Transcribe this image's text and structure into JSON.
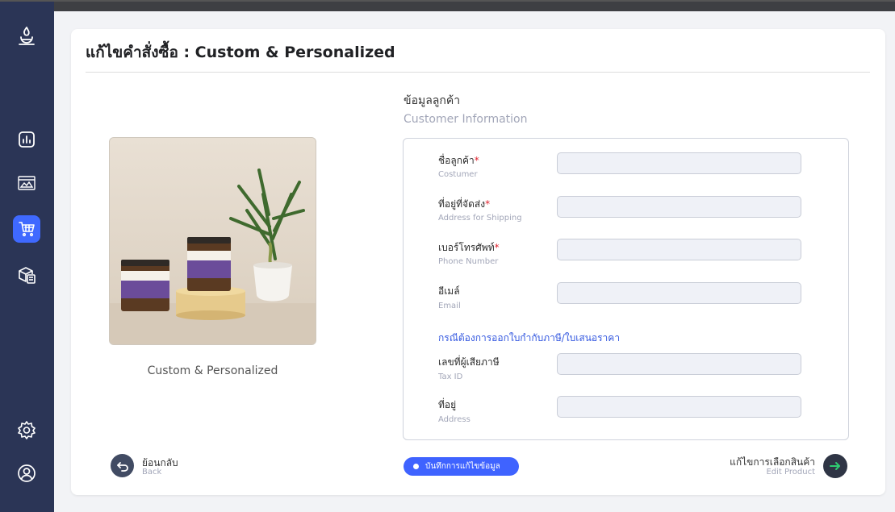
{
  "page": {
    "title": "แก้ไขคำสั่งซื้อ : Custom & Personalized"
  },
  "sidebar": {
    "items": [
      {
        "icon": "brand-logo-icon"
      },
      {
        "icon": "chart-icon"
      },
      {
        "icon": "banner-icon"
      },
      {
        "icon": "cart-icon",
        "active": true
      },
      {
        "icon": "product-box-icon"
      },
      {
        "icon": "gear-icon"
      },
      {
        "icon": "profile-icon"
      }
    ]
  },
  "product": {
    "image_icon": "product-photo",
    "name": "Custom & Personalized"
  },
  "customer": {
    "section_th": "ข้อมูลลูกค้า",
    "section_en": "Customer Information",
    "required_mark": "*",
    "fields": {
      "name": {
        "label_th": "ชื่อลูกค้า",
        "label_en": "Costumer",
        "value": ""
      },
      "address": {
        "label_th": "ที่อยู่ที่จัดส่ง",
        "label_en": "Address for Shipping",
        "value": ""
      },
      "phone": {
        "label_th": "เบอร์โทรศัพท์",
        "label_en": "Phone Number",
        "value": ""
      },
      "email": {
        "label_th": "อีเมล์",
        "label_en": "Email",
        "value": ""
      }
    },
    "tax_note": "กรณีต้องการออกใบกำกับภาษี/ใบเสนอราคา",
    "tax_fields": {
      "tax_id": {
        "label_th": "เลขที่ผู้เสียภาษี",
        "label_en": "Tax ID",
        "value": ""
      },
      "tax_address": {
        "label_th": "ที่อยู่",
        "label_en": "Address",
        "value": ""
      }
    }
  },
  "footer": {
    "back_th": "ย้อนกลับ",
    "back_en": "Back",
    "save_label": "บันทึกการแก้ไขข้อมูล",
    "next_th": "แก้ไขการเลือกสินค้า",
    "next_en": "Edit Product"
  },
  "colors": {
    "sidebar_bg": "#2b3556",
    "accent": "#3f63ff",
    "next_arrow": "#2ecc71",
    "required": "#e0222d"
  }
}
